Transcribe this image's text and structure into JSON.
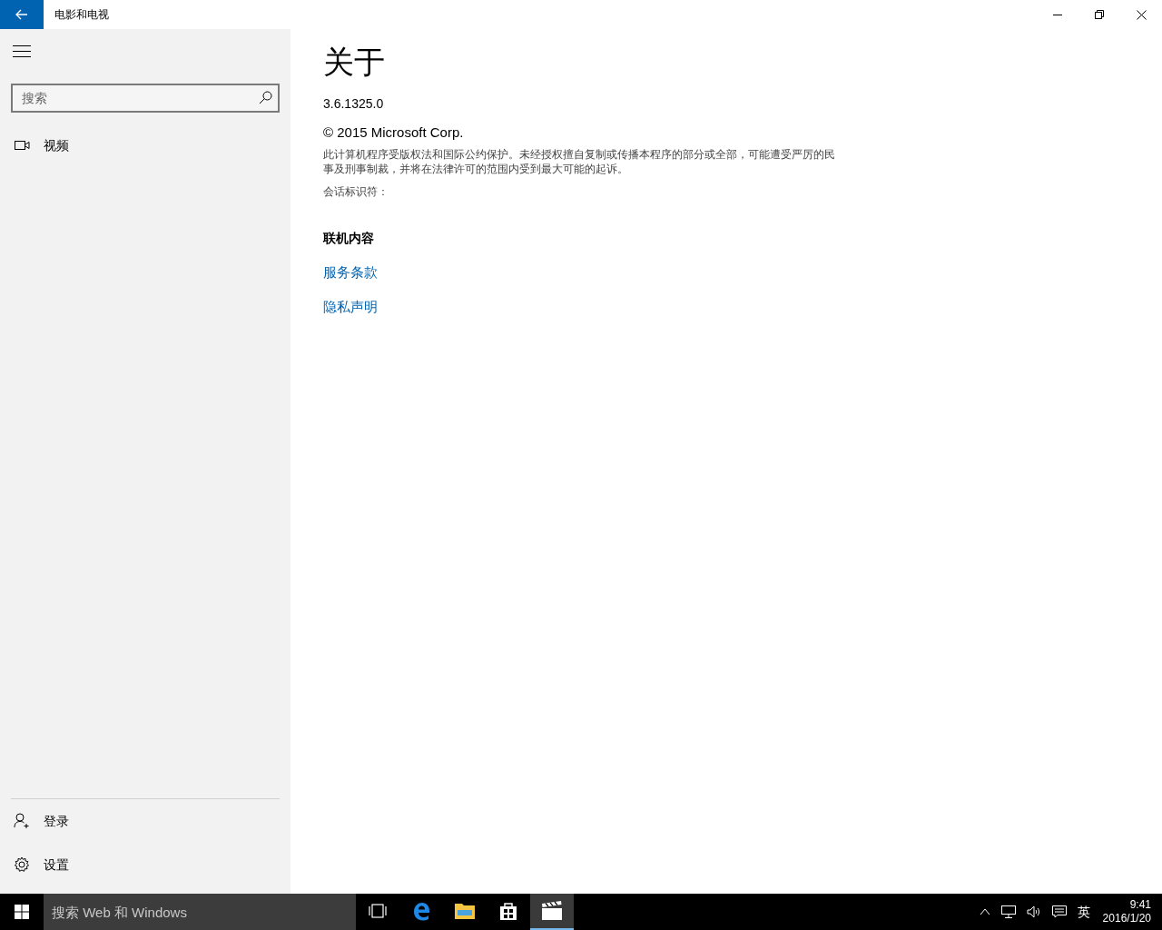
{
  "window": {
    "title": "电影和电视"
  },
  "sidebar": {
    "search": {
      "placeholder": "搜索"
    },
    "nav_items": [
      {
        "kind": "video",
        "label": "视频"
      }
    ],
    "bottom_items": [
      {
        "kind": "account",
        "label": "登录"
      },
      {
        "kind": "settings",
        "label": "设置"
      }
    ]
  },
  "content": {
    "heading": "关于",
    "version": "3.6.1325.0",
    "copyright": "© 2015 Microsoft Corp.",
    "legal": "此计算机程序受版权法和国际公约保护。未经授权擅自复制或传播本程序的部分或全部，可能遭受严厉的民事及刑事制裁，并将在法律许可的范围内受到最大可能的起诉。",
    "session_label": "会话标识符：",
    "section_heading": "联机内容",
    "links": [
      "服务条款",
      "隐私声明"
    ]
  },
  "taskbar": {
    "search": {
      "placeholder": "搜索 Web 和 Windows"
    },
    "apps": [
      {
        "kind": "task-view",
        "active": false
      },
      {
        "kind": "edge",
        "active": false
      },
      {
        "kind": "explorer",
        "active": false
      },
      {
        "kind": "store",
        "active": false
      },
      {
        "kind": "movies",
        "active": true
      }
    ],
    "ime": "英",
    "time": "9:41",
    "date": "2016/1/20"
  }
}
